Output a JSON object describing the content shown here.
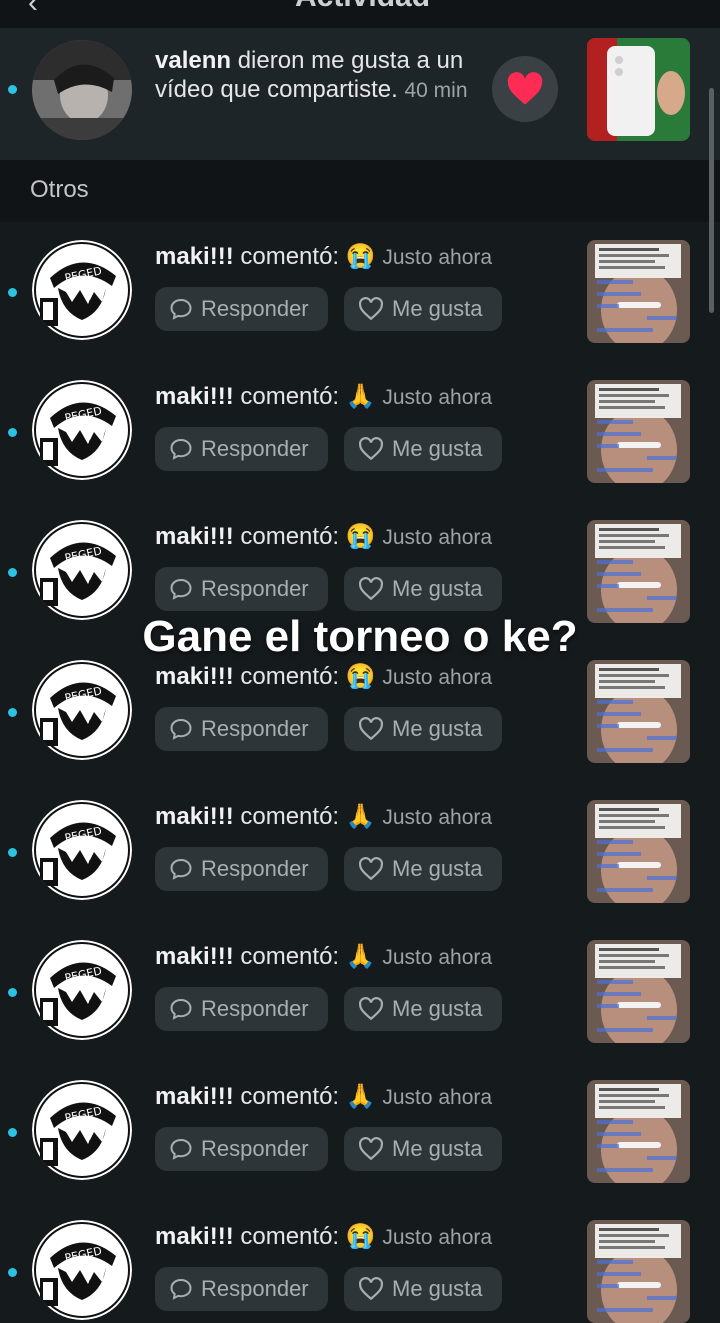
{
  "header": {
    "back_icon": "chevron-left-icon",
    "title": "Actividad"
  },
  "like_notification": {
    "username": "valenn",
    "text": "dieron me gusta a un vídeo que compartiste.",
    "time": "40 min",
    "action_icon": "heart-icon",
    "heart_color": "#fe2c55"
  },
  "section_label": "Otros",
  "comment_prefix": "comentó:",
  "buttons": {
    "reply": "Responder",
    "like": "Me gusta"
  },
  "comments": [
    {
      "username": "maki!!!",
      "emoji": "😭",
      "time": "Justo ahora"
    },
    {
      "username": "maki!!!",
      "emoji": "🙏",
      "time": "Justo ahora"
    },
    {
      "username": "maki!!!",
      "emoji": "😭",
      "time": "Justo ahora"
    },
    {
      "username": "maki!!!",
      "emoji": "😭",
      "time": "Justo ahora"
    },
    {
      "username": "maki!!!",
      "emoji": "🙏",
      "time": "Justo ahora"
    },
    {
      "username": "maki!!!",
      "emoji": "🙏",
      "time": "Justo ahora"
    },
    {
      "username": "maki!!!",
      "emoji": "🙏",
      "time": "Justo ahora"
    },
    {
      "username": "maki!!!",
      "emoji": "😭",
      "time": "Justo ahora"
    }
  ],
  "overlay_caption": "Gane el torneo o ke?",
  "colors": {
    "unread_dot": "#2bc3e3",
    "background": "#151a1d"
  }
}
